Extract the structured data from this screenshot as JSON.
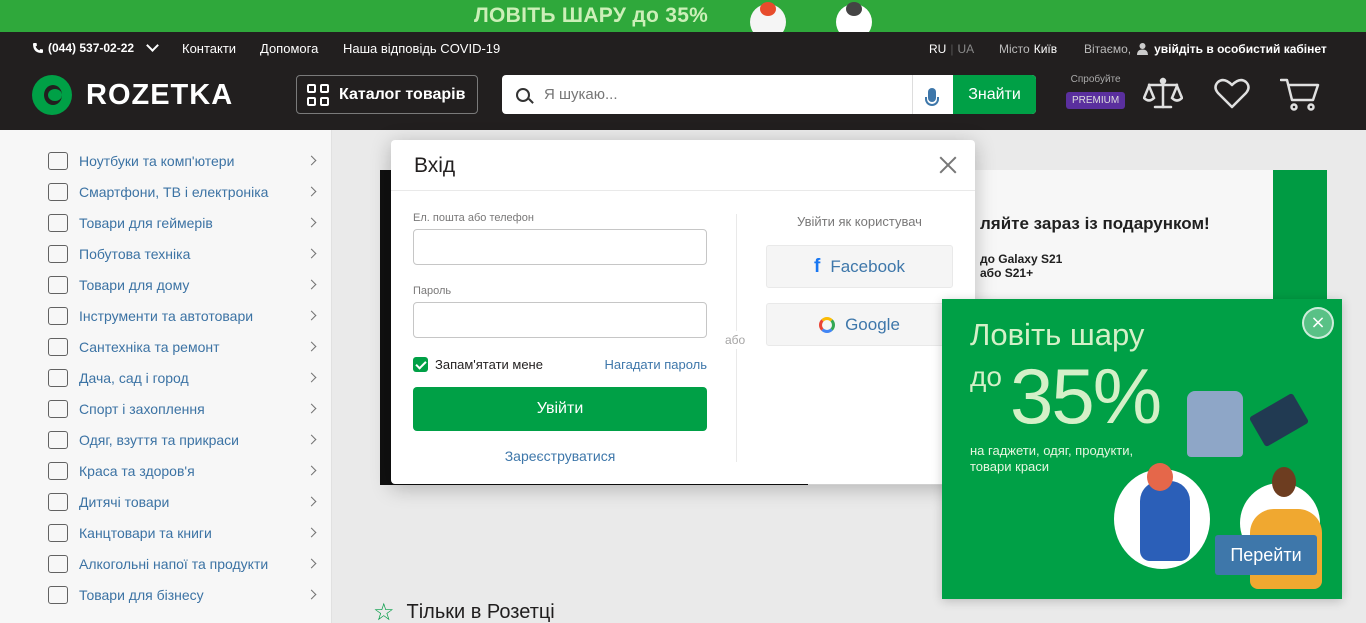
{
  "promo_banner": {
    "text": "ЛОВІТЬ ШАРУ до 35%"
  },
  "header": {
    "phone": "(044) 537-02-22",
    "links": [
      "Контакти",
      "Допомога",
      "Наша відповідь COVID-19"
    ],
    "lang": {
      "ru": "RU",
      "ua": "UA"
    },
    "city_label": "Місто",
    "city": "Київ",
    "greeting": "Вітаємо,",
    "cabinet": "увійдіть в особистий кабінет",
    "logo": "ROZETKA",
    "catalog": "Каталог товарів",
    "search_placeholder": "Я шукаю...",
    "search_button": "Знайти",
    "premium_try": "Спробуйте",
    "premium": "PREMIUM"
  },
  "sidebar": {
    "items": [
      {
        "label": "Ноутбуки та комп'ютери",
        "icon": "laptop-icon"
      },
      {
        "label": "Смартфони, ТВ і електроніка",
        "icon": "smartphone-icon"
      },
      {
        "label": "Товари для геймерів",
        "icon": "gamepad-icon"
      },
      {
        "label": "Побутова техніка",
        "icon": "washing-machine-icon"
      },
      {
        "label": "Товари для дому",
        "icon": "armchair-icon"
      },
      {
        "label": "Інструменти та автотовари",
        "icon": "drill-icon"
      },
      {
        "label": "Сантехніка та ремонт",
        "icon": "bathtub-icon"
      },
      {
        "label": "Дача, сад і город",
        "icon": "rake-icon"
      },
      {
        "label": "Спорт і захоплення",
        "icon": "racket-icon"
      },
      {
        "label": "Одяг, взуття та прикраси",
        "icon": "tshirt-icon"
      },
      {
        "label": "Краса та здоров'я",
        "icon": "cosmetics-icon"
      },
      {
        "label": "Дитячі товари",
        "icon": "bear-icon"
      },
      {
        "label": "Канцтовари та книги",
        "icon": "clip-icon"
      },
      {
        "label": "Алкогольні напої та продукти",
        "icon": "cocktail-icon"
      },
      {
        "label": "Товари для бізнесу",
        "icon": "barcode-icon"
      }
    ]
  },
  "main": {
    "hero_heading": "ляйте зараз із подарунком!",
    "hero_line1": "до Galaxy S21",
    "hero_line2": "або S21+",
    "only_title": "Тільки в Розетці"
  },
  "login_modal": {
    "title": "Вхід",
    "email_label": "Ел. пошта або телефон",
    "email_value": "",
    "password_label": "Пароль",
    "password_value": "",
    "remember": "Запам'ятати мене",
    "forgot": "Нагадати пароль",
    "submit": "Увійти",
    "register": "Зареєструватися",
    "or": "або",
    "social_heading": "Увійти як користувач",
    "facebook": "Facebook",
    "google": "Google"
  },
  "promo_popup": {
    "title": "Ловіть шару",
    "do": "до",
    "percent": "35%",
    "subtitle": "на гаджети, одяг, продукти, товари краси",
    "button": "Перейти"
  },
  "colors": {
    "brand_green": "#00a046",
    "header_bg": "#221f1f",
    "link_blue": "#3e77aa",
    "premium_purple": "#5a2f9e"
  }
}
